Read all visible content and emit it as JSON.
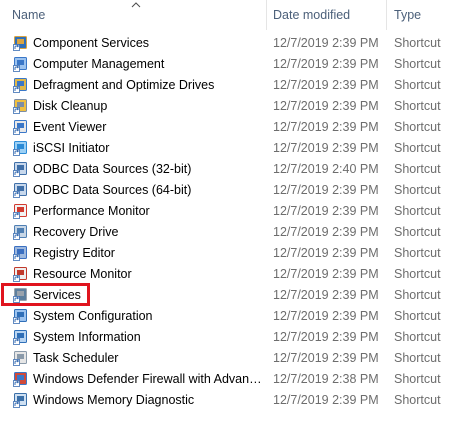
{
  "header": {
    "name_label": "Name",
    "date_label": "Date modified",
    "type_label": "Type",
    "sort_icon": "chevron-up-icon"
  },
  "rows": [
    {
      "name": "Component Services",
      "date": "12/7/2019 2:39 PM",
      "type": "Shortcut",
      "icon": "component-services-icon"
    },
    {
      "name": "Computer Management",
      "date": "12/7/2019 2:39 PM",
      "type": "Shortcut",
      "icon": "computer-management-icon"
    },
    {
      "name": "Defragment and Optimize Drives",
      "date": "12/7/2019 2:39 PM",
      "type": "Shortcut",
      "icon": "defragment-icon"
    },
    {
      "name": "Disk Cleanup",
      "date": "12/7/2019 2:39 PM",
      "type": "Shortcut",
      "icon": "disk-cleanup-icon"
    },
    {
      "name": "Event Viewer",
      "date": "12/7/2019 2:39 PM",
      "type": "Shortcut",
      "icon": "event-viewer-icon"
    },
    {
      "name": "iSCSI Initiator",
      "date": "12/7/2019 2:39 PM",
      "type": "Shortcut",
      "icon": "iscsi-initiator-icon"
    },
    {
      "name": "ODBC Data Sources (32-bit)",
      "date": "12/7/2019 2:40 PM",
      "type": "Shortcut",
      "icon": "odbc-icon"
    },
    {
      "name": "ODBC Data Sources (64-bit)",
      "date": "12/7/2019 2:39 PM",
      "type": "Shortcut",
      "icon": "odbc-icon"
    },
    {
      "name": "Performance Monitor",
      "date": "12/7/2019 2:39 PM",
      "type": "Shortcut",
      "icon": "performance-monitor-icon"
    },
    {
      "name": "Recovery Drive",
      "date": "12/7/2019 2:39 PM",
      "type": "Shortcut",
      "icon": "recovery-drive-icon"
    },
    {
      "name": "Registry Editor",
      "date": "12/7/2019 2:39 PM",
      "type": "Shortcut",
      "icon": "registry-editor-icon"
    },
    {
      "name": "Resource Monitor",
      "date": "12/7/2019 2:39 PM",
      "type": "Shortcut",
      "icon": "resource-monitor-icon"
    },
    {
      "name": "Services",
      "date": "12/7/2019 2:39 PM",
      "type": "Shortcut",
      "icon": "services-icon"
    },
    {
      "name": "System Configuration",
      "date": "12/7/2019 2:39 PM",
      "type": "Shortcut",
      "icon": "system-configuration-icon"
    },
    {
      "name": "System Information",
      "date": "12/7/2019 2:39 PM",
      "type": "Shortcut",
      "icon": "system-information-icon"
    },
    {
      "name": "Task Scheduler",
      "date": "12/7/2019 2:39 PM",
      "type": "Shortcut",
      "icon": "task-scheduler-icon"
    },
    {
      "name": "Windows Defender Firewall with Advanc...",
      "date": "12/7/2019 2:38 PM",
      "type": "Shortcut",
      "icon": "firewall-icon"
    },
    {
      "name": "Windows Memory Diagnostic",
      "date": "12/7/2019 2:39 PM",
      "type": "Shortcut",
      "icon": "memory-diagnostic-icon"
    }
  ],
  "highlight": {
    "row": "Services",
    "color": "#e0141e"
  },
  "colors": {
    "header_text": "#4c607a",
    "secondary_text": "#6d6d6d",
    "primary_text": "#000000"
  }
}
